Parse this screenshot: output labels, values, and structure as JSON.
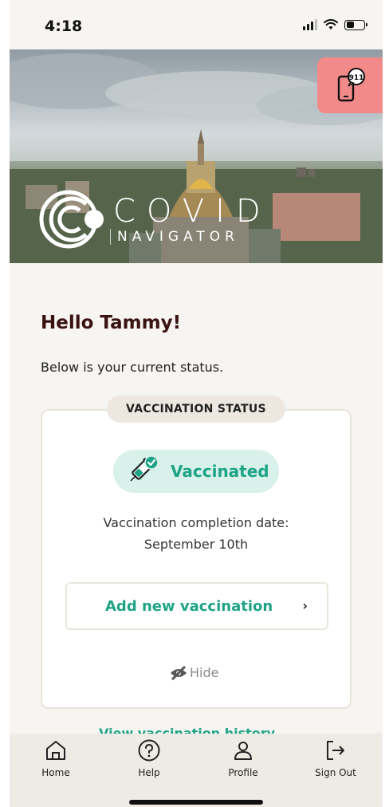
{
  "status_bar": {
    "time": "4:18"
  },
  "hero": {
    "logo_word": "COVID",
    "logo_sub": "NAVIGATOR",
    "emergency_icon_text": "911"
  },
  "greeting": "Hello Tammy!",
  "subtitle": "Below is your current status.",
  "vaccination_card": {
    "header": "VACCINATION STATUS",
    "status_label": "Vaccinated",
    "completion_label": "Vaccination completion date:",
    "completion_date": "September 10th",
    "add_button_label": "Add new vaccination",
    "hide_label": "Hide"
  },
  "history_link": "View vaccination history",
  "tab_bar": {
    "items": [
      {
        "label": "Home",
        "icon": "home-icon"
      },
      {
        "label": "Help",
        "icon": "help-icon"
      },
      {
        "label": "Profile",
        "icon": "profile-icon"
      },
      {
        "label": "Sign Out",
        "icon": "sign-out-icon"
      }
    ]
  },
  "colors": {
    "accent": "#1ea387",
    "greeting": "#3a1212",
    "emergency": "#f38a8a",
    "background": "#f7f5f1"
  }
}
